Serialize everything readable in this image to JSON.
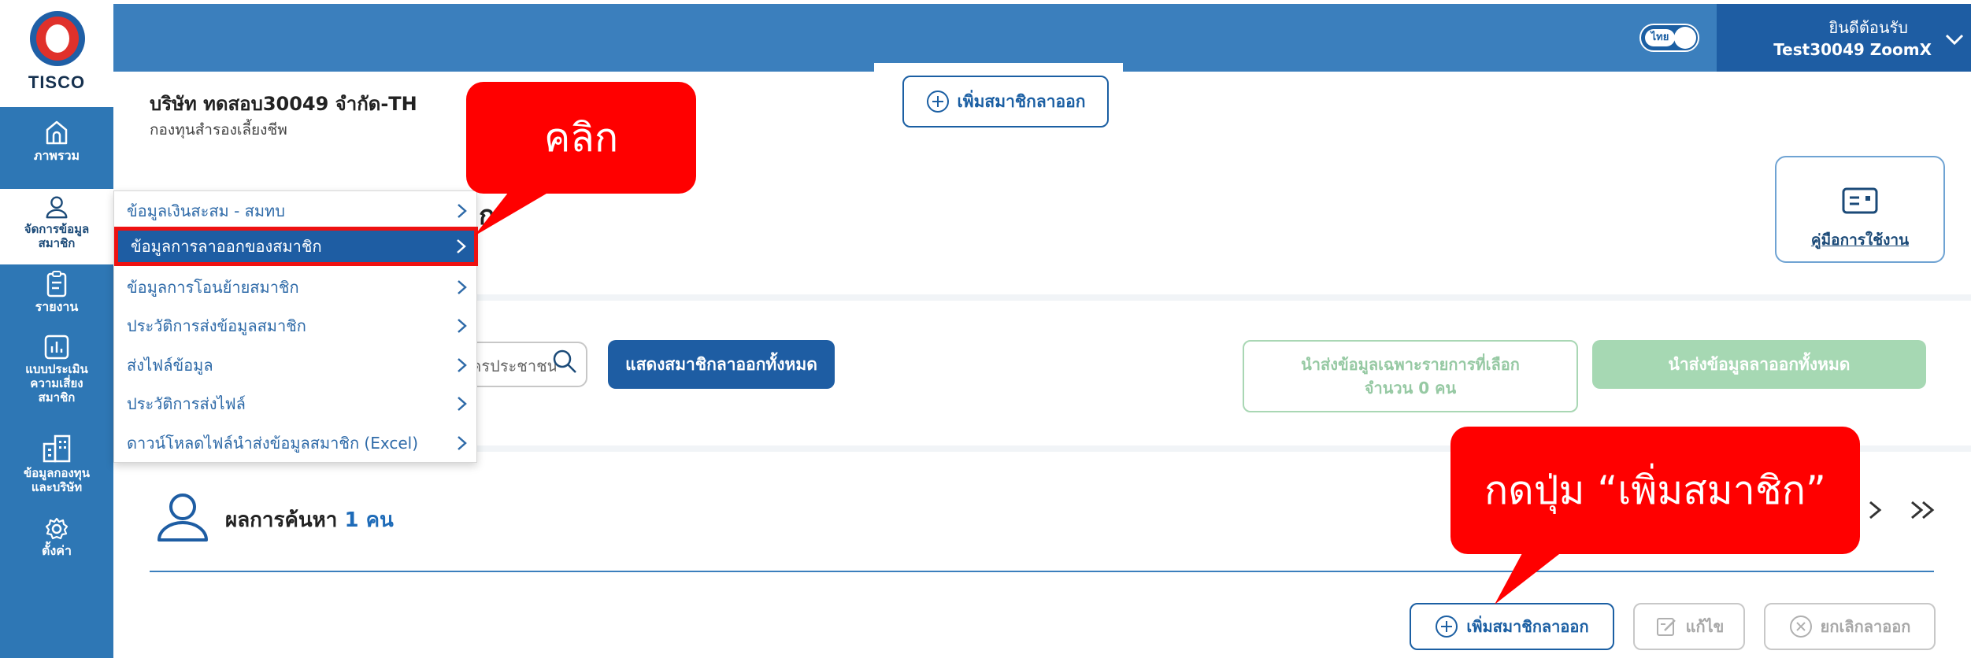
{
  "brand": {
    "logo_text": "TISCO"
  },
  "nav": {
    "items": [
      {
        "label": "ภาพรวม",
        "icon": "home-icon"
      },
      {
        "label": "จัดการข้อมูล\nสมาชิก",
        "icon": "user-icon"
      },
      {
        "label": "รายงาน",
        "icon": "report-icon"
      },
      {
        "label": "แบบประเมิน\nความเสี่ยง\nสมาชิก",
        "icon": "chart-icon"
      },
      {
        "label": "ข้อมูลกองทุน\nและบริษัท",
        "icon": "building-icon"
      },
      {
        "label": "ตั้งค่า",
        "icon": "gear-icon"
      }
    ],
    "active_index": 1
  },
  "header": {
    "language": "ไทย",
    "welcome": "ยินดีต้อนรับ",
    "username": "Test30049 ZoomX"
  },
  "company": {
    "name": "บริษัท ทดสอบ30049 จำกัด-TH",
    "fund_type": "กองทุนสำรองเลี้ยงชีพ"
  },
  "page": {
    "title_fragment": "ก",
    "top_add_button": "เพิ่มสมาชิกลาออก",
    "manual_label": "คู่มือการใช้งาน"
  },
  "search": {
    "placeholder_visible": "ครประชาชน"
  },
  "actions": {
    "show_all": "แสดงสมาชิกลาออกทั้งหมด",
    "export_selected": "นำส่งข้อมูลเฉพาะรายการที่เลือก\nจำนวน 0 คน",
    "export_all": "นำส่งข้อมูลลาออกทั้งหมด"
  },
  "results": {
    "label": "ผลการค้นหา",
    "count": "1 คน"
  },
  "bottom_actions": {
    "add": "เพิ่มสมาชิกลาออก",
    "edit": "แก้ไข",
    "cancel": "ยกเลิกลาออก"
  },
  "dropdown": {
    "items": [
      "ข้อมูลเงินสะสม - สมทบ",
      "ข้อมูลการลาออกของสมาชิก",
      "ข้อมูลการโอนย้ายสมาชิก",
      "ประวัติการส่งข้อมูลสมาชิก",
      "ส่งไฟล์ข้อมูล",
      "ประวัติการส่งไฟล์",
      "ดาวน์โหลดไฟล์นำส่งข้อมูลสมาชิก (Excel)"
    ],
    "selected_index": 1
  },
  "callouts": {
    "click": "คลิก",
    "press_add": "กดปุ่ม “เพิ่มสมาชิก”"
  },
  "colors": {
    "primary": "#1e5da3",
    "header": "#3b7fbd",
    "callout": "#ff0000",
    "success_light": "#a6d8b3"
  }
}
